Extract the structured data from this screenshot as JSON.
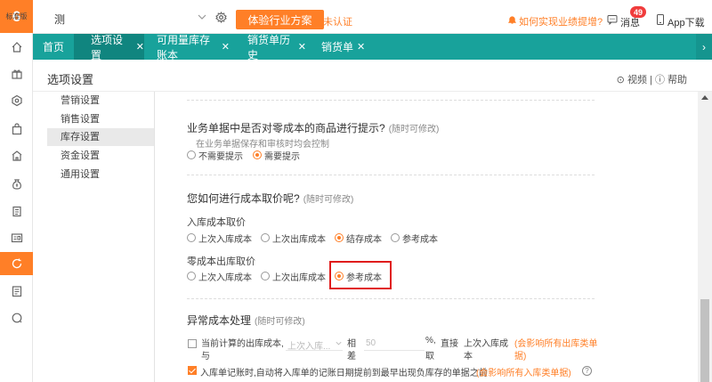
{
  "brand": {
    "logo_mark": "6",
    "logo_text": "标准版",
    "accent": "#ff7f27",
    "nav_color": "#18a29b"
  },
  "rail": {
    "icons": [
      "home-icon",
      "gift-icon",
      "settings-icon",
      "bag-icon",
      "shop-icon",
      "money-bag-icon",
      "clipboard-icon",
      "report-icon",
      "refresh-icon",
      "document-icon",
      "chat-icon"
    ],
    "active": "refresh-icon"
  },
  "topbar": {
    "store_value": "测",
    "plan_button": "体验行业方案",
    "unverified": "未认证",
    "help_link": "如何实现业绩提增?",
    "messages_label": "消息",
    "messages_count": "49",
    "app_download": "App下载"
  },
  "tabs": [
    {
      "label": "首页",
      "closable": false,
      "active": false
    },
    {
      "label": "选项设置",
      "closable": true,
      "active": true
    },
    {
      "label": "可用量库存账本",
      "closable": true,
      "active": false
    },
    {
      "label": "销货单历史",
      "closable": true,
      "active": false
    },
    {
      "label": "销货单",
      "closable": true,
      "active": false
    }
  ],
  "page": {
    "title": "选项设置",
    "video_label": "视频",
    "help_label": "帮助"
  },
  "menu": [
    "营销设置",
    "销售设置",
    "库存设置",
    "资金设置",
    "通用设置"
  ],
  "menu_selected": "库存设置",
  "sections": {
    "zero_cost": {
      "title": "业务单据中是否对零成本的商品进行提示?",
      "hint": "(随时可修改)",
      "sub": "在业务单据保存和审核时均会控制",
      "options": [
        "不需要提示",
        "需要提示"
      ],
      "selected": "需要提示"
    },
    "cost_method": {
      "title": "您如何进行成本取价呢?",
      "hint": "(随时可修改)",
      "inbound_label": "入库成本取价",
      "inbound_options": [
        "上次入库成本",
        "上次出库成本",
        "结存成本",
        "参考成本"
      ],
      "inbound_selected": "结存成本",
      "zero_out_label": "零成本出库取价",
      "zero_out_options": [
        "上次入库成本",
        "上次出库成本",
        "参考成本"
      ],
      "zero_out_selected": "参考成本"
    },
    "abnormal": {
      "title": "异常成本处理",
      "hint": "(随时可修改)",
      "row1_text_a": "当前计算的出库成本,",
      "row1_text_b": "与",
      "row1_select_placeholder": "上次入库...",
      "row1_xiang": "相",
      "row1_cha": "差",
      "row1_value": "50",
      "row1_percent": "%,",
      "row1_zhijie": "直接",
      "row1_qu": "取",
      "row1_take": "上次入库成",
      "row1_take2": "本",
      "row1_warn": "(会影响所有出库类单",
      "row1_warn2": "据)",
      "row1_checked": false,
      "row2_text": "入库单记账时,自动将入库单的记账日期提前到最早出现负库存的单据之前",
      "row2_warn": "(会影响所有入库类单据)",
      "row2_checked": true
    }
  }
}
